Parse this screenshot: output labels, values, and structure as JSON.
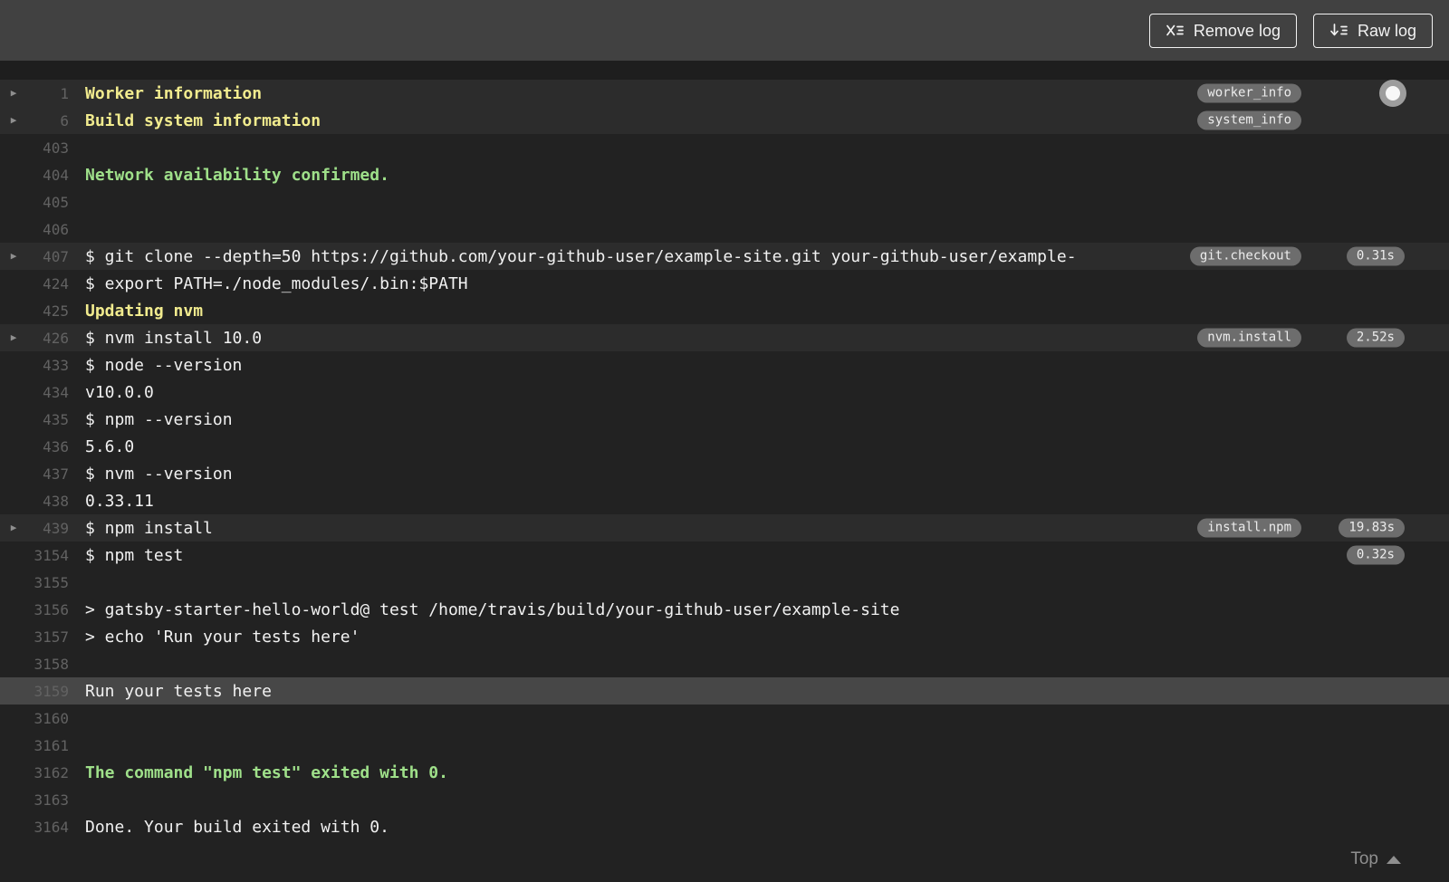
{
  "header": {
    "remove_log_label": "Remove log",
    "raw_log_label": "Raw log"
  },
  "colors": {
    "topbar_bg": "#414141",
    "log_bg": "#222222",
    "section_header_bg": "#2c2c2c",
    "selected_row_bg": "#474747",
    "text": "#f1f1f1",
    "line_number": "#626262",
    "fold_yellow": "#f1eb8e",
    "success_green": "#9fe08a",
    "pill_bg": "#6d6d6d"
  },
  "icons": {
    "remove_log": "x-list-icon",
    "raw_log": "arrow-down-list-icon",
    "fold": "chevron-right-icon",
    "top": "caret-up-icon",
    "knob": "scroll-knob"
  },
  "log": {
    "rows": [
      {
        "num": "1",
        "text": "Worker information",
        "style": "yellow",
        "fold": true,
        "section_header": true,
        "tag": "worker_info",
        "knob": true
      },
      {
        "num": "6",
        "text": "Build system information",
        "style": "yellow",
        "fold": true,
        "section_header": true,
        "tag": "system_info"
      },
      {
        "num": "403",
        "text": ""
      },
      {
        "num": "404",
        "text": "Network availability confirmed.",
        "style": "green"
      },
      {
        "num": "405",
        "text": ""
      },
      {
        "num": "406",
        "text": ""
      },
      {
        "num": "407",
        "text": "$ git clone --depth=50 https://github.com/your-github-user/example-site.git your-github-user/example-",
        "fold": true,
        "section_header": true,
        "tag": "git.checkout",
        "duration": "0.31s"
      },
      {
        "num": "424",
        "text": "$ export PATH=./node_modules/.bin:$PATH"
      },
      {
        "num": "425",
        "text": "Updating nvm",
        "style": "yellow"
      },
      {
        "num": "426",
        "text": "$ nvm install 10.0",
        "fold": true,
        "section_header": true,
        "tag": "nvm.install",
        "duration": "2.52s"
      },
      {
        "num": "433",
        "text": "$ node --version"
      },
      {
        "num": "434",
        "text": "v10.0.0"
      },
      {
        "num": "435",
        "text": "$ npm --version"
      },
      {
        "num": "436",
        "text": "5.6.0"
      },
      {
        "num": "437",
        "text": "$ nvm --version"
      },
      {
        "num": "438",
        "text": "0.33.11"
      },
      {
        "num": "439",
        "text": "$ npm install",
        "fold": true,
        "section_header": true,
        "tag": "install.npm",
        "duration": "19.83s"
      },
      {
        "num": "3154",
        "text": "$ npm test",
        "duration": "0.32s"
      },
      {
        "num": "3155",
        "text": ""
      },
      {
        "num": "3156",
        "text": "> gatsby-starter-hello-world@ test /home/travis/build/your-github-user/example-site"
      },
      {
        "num": "3157",
        "text": "> echo 'Run your tests here'"
      },
      {
        "num": "3158",
        "text": ""
      },
      {
        "num": "3159",
        "text": "Run your tests here",
        "selected": true
      },
      {
        "num": "3160",
        "text": ""
      },
      {
        "num": "3161",
        "text": ""
      },
      {
        "num": "3162",
        "text": "The command \"npm test\" exited with 0.",
        "style": "green"
      },
      {
        "num": "3163",
        "text": ""
      },
      {
        "num": "3164",
        "text": "Done. Your build exited with 0."
      }
    ]
  },
  "footer": {
    "top_label": "Top"
  }
}
